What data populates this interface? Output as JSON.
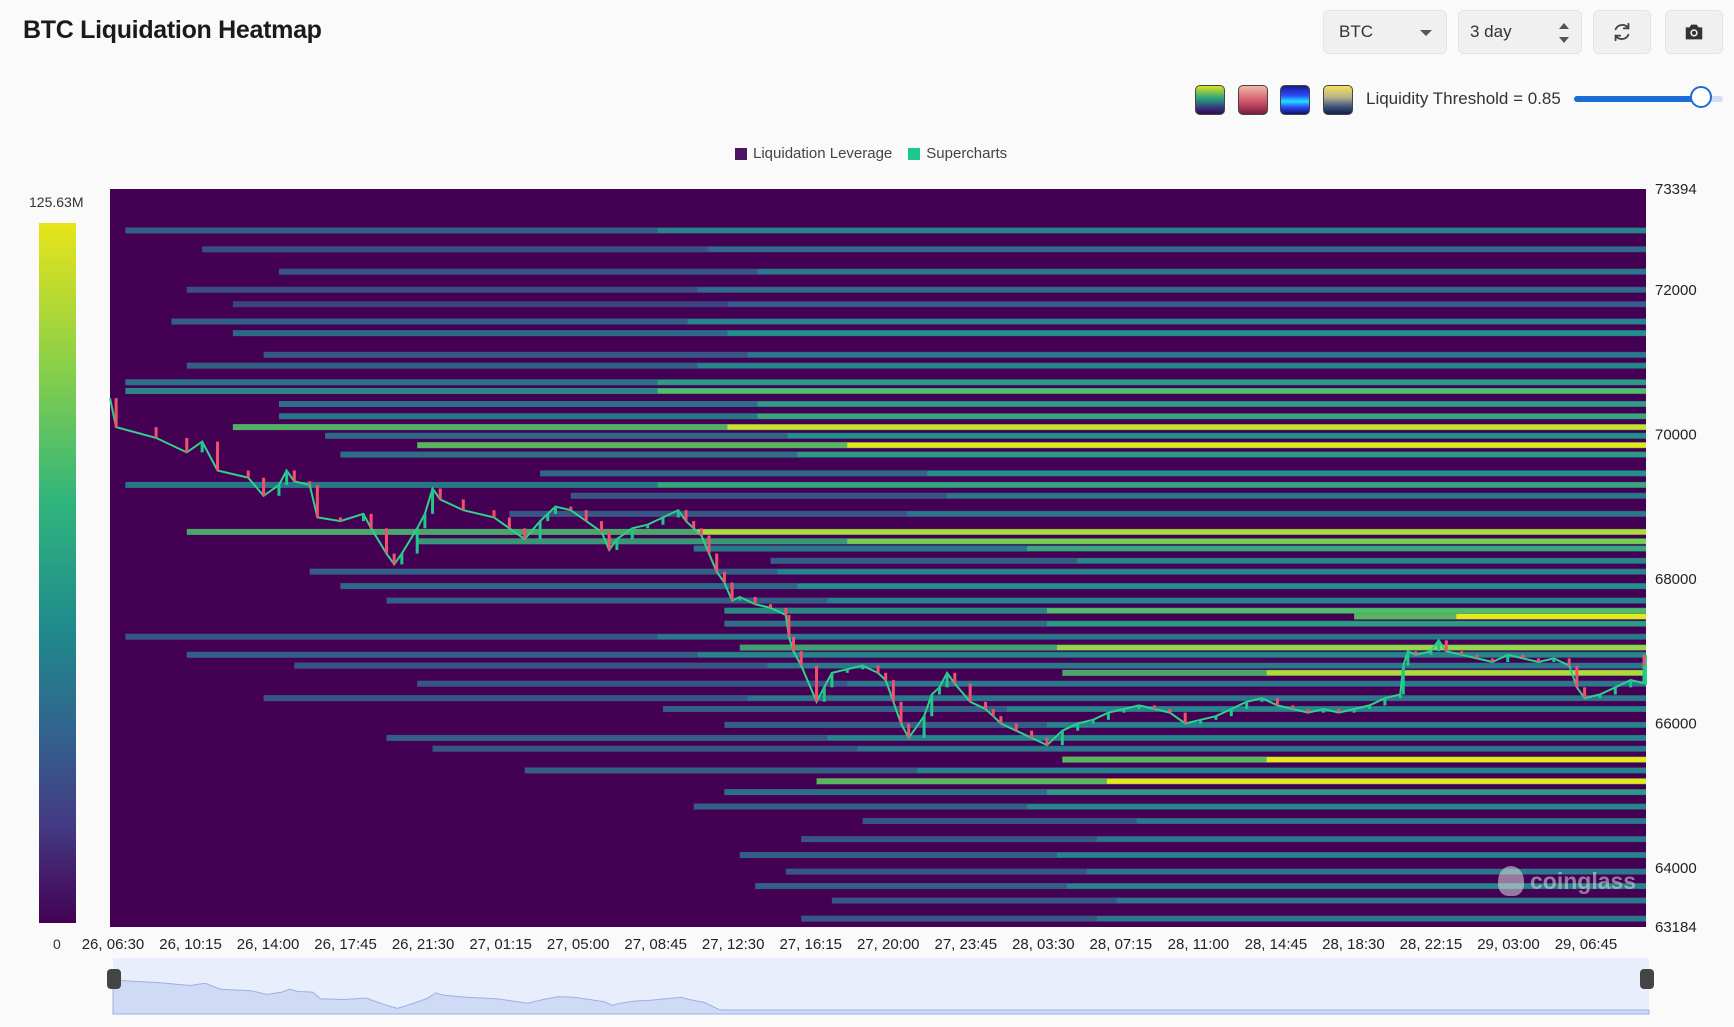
{
  "header": {
    "title": "BTC Liquidation Heatmap",
    "asset_select": "BTC",
    "period_select": "3 day",
    "refresh_icon": "refresh-icon",
    "camera_icon": "camera-icon"
  },
  "palette": {
    "swatches": [
      "viridis",
      "reds",
      "blue-cyan",
      "cividis"
    ],
    "threshold_label": "Liquidity Threshold = 0.85",
    "threshold_value": 0.85
  },
  "legend": {
    "items": [
      {
        "label": "Liquidation Leverage",
        "color": "#4a1560"
      },
      {
        "label": "Supercharts",
        "color": "#1ec88a"
      }
    ]
  },
  "colorbar": {
    "max_label": "125.63M",
    "min_label": "0"
  },
  "chart_data": {
    "type": "heatmap",
    "title": "",
    "x_ticks": [
      "26, 06:30",
      "26, 10:15",
      "26, 14:00",
      "26, 17:45",
      "26, 21:30",
      "27, 01:15",
      "27, 05:00",
      "27, 08:45",
      "27, 12:30",
      "27, 16:15",
      "27, 20:00",
      "27, 23:45",
      "28, 03:30",
      "28, 07:15",
      "28, 11:00",
      "28, 14:45",
      "28, 18:30",
      "28, 22:15",
      "29, 03:00",
      "29, 06:45"
    ],
    "y_ticks": [
      73394,
      72000,
      70000,
      68000,
      66000,
      64000,
      63184
    ],
    "ylim": [
      63184,
      73394
    ],
    "colorbar_range": [
      "0",
      "125.63M"
    ],
    "background_color": "#440154",
    "liquidation_bands": [
      {
        "price": 72820,
        "start": 0.01,
        "intensity": 0.45
      },
      {
        "price": 72560,
        "start": 0.06,
        "intensity": 0.35
      },
      {
        "price": 72250,
        "start": 0.11,
        "intensity": 0.4
      },
      {
        "price": 72000,
        "start": 0.05,
        "intensity": 0.35
      },
      {
        "price": 71800,
        "start": 0.08,
        "intensity": 0.3
      },
      {
        "price": 71560,
        "start": 0.04,
        "intensity": 0.45
      },
      {
        "price": 71400,
        "start": 0.08,
        "intensity": 0.5
      },
      {
        "price": 71100,
        "start": 0.1,
        "intensity": 0.4
      },
      {
        "price": 70950,
        "start": 0.05,
        "intensity": 0.45
      },
      {
        "price": 70720,
        "start": 0.01,
        "intensity": 0.55
      },
      {
        "price": 70600,
        "start": 0.01,
        "intensity": 0.7
      },
      {
        "price": 70420,
        "start": 0.11,
        "intensity": 0.55
      },
      {
        "price": 70250,
        "start": 0.11,
        "intensity": 0.6
      },
      {
        "price": 70100,
        "start": 0.08,
        "intensity": 0.95
      },
      {
        "price": 69980,
        "start": 0.14,
        "intensity": 0.5
      },
      {
        "price": 69850,
        "start": 0.2,
        "intensity": 1.0
      },
      {
        "price": 69720,
        "start": 0.15,
        "intensity": 0.55
      },
      {
        "price": 69460,
        "start": 0.28,
        "intensity": 0.5
      },
      {
        "price": 69300,
        "start": 0.01,
        "intensity": 0.6
      },
      {
        "price": 69150,
        "start": 0.3,
        "intensity": 0.4
      },
      {
        "price": 68900,
        "start": 0.26,
        "intensity": 0.4
      },
      {
        "price": 68650,
        "start": 0.05,
        "intensity": 0.9
      },
      {
        "price": 68520,
        "start": 0.2,
        "intensity": 0.8
      },
      {
        "price": 68420,
        "start": 0.38,
        "intensity": 0.6
      },
      {
        "price": 68250,
        "start": 0.43,
        "intensity": 0.45
      },
      {
        "price": 68100,
        "start": 0.13,
        "intensity": 0.45
      },
      {
        "price": 67900,
        "start": 0.15,
        "intensity": 0.5
      },
      {
        "price": 67700,
        "start": 0.18,
        "intensity": 0.45
      },
      {
        "price": 67560,
        "start": 0.4,
        "intensity": 0.7
      },
      {
        "price": 67480,
        "start": 0.81,
        "intensity": 1.0
      },
      {
        "price": 67380,
        "start": 0.4,
        "intensity": 0.55
      },
      {
        "price": 67200,
        "start": 0.01,
        "intensity": 0.4
      },
      {
        "price": 67050,
        "start": 0.41,
        "intensity": 0.85
      },
      {
        "price": 66950,
        "start": 0.05,
        "intensity": 0.45
      },
      {
        "price": 66800,
        "start": 0.12,
        "intensity": 0.4
      },
      {
        "price": 66700,
        "start": 0.62,
        "intensity": 0.9
      },
      {
        "price": 66550,
        "start": 0.2,
        "intensity": 0.4
      },
      {
        "price": 66350,
        "start": 0.1,
        "intensity": 0.4
      },
      {
        "price": 66200,
        "start": 0.36,
        "intensity": 0.45
      },
      {
        "price": 65980,
        "start": 0.4,
        "intensity": 0.45
      },
      {
        "price": 65800,
        "start": 0.18,
        "intensity": 0.45
      },
      {
        "price": 65650,
        "start": 0.21,
        "intensity": 0.4
      },
      {
        "price": 65500,
        "start": 0.62,
        "intensity": 1.0
      },
      {
        "price": 65350,
        "start": 0.27,
        "intensity": 0.45
      },
      {
        "price": 65200,
        "start": 0.46,
        "intensity": 1.0
      },
      {
        "price": 65050,
        "start": 0.4,
        "intensity": 0.55
      },
      {
        "price": 64850,
        "start": 0.38,
        "intensity": 0.45
      },
      {
        "price": 64650,
        "start": 0.49,
        "intensity": 0.4
      },
      {
        "price": 64400,
        "start": 0.45,
        "intensity": 0.4
      },
      {
        "price": 64180,
        "start": 0.41,
        "intensity": 0.45
      },
      {
        "price": 63950,
        "start": 0.44,
        "intensity": 0.4
      },
      {
        "price": 63750,
        "start": 0.42,
        "intensity": 0.45
      },
      {
        "price": 63550,
        "start": 0.47,
        "intensity": 0.4
      },
      {
        "price": 63300,
        "start": 0.45,
        "intensity": 0.4
      }
    ],
    "price_path": [
      [
        0.0,
        70500
      ],
      [
        0.004,
        70100
      ],
      [
        0.03,
        69950
      ],
      [
        0.05,
        69750
      ],
      [
        0.06,
        69900
      ],
      [
        0.07,
        69500
      ],
      [
        0.09,
        69400
      ],
      [
        0.1,
        69150
      ],
      [
        0.11,
        69300
      ],
      [
        0.115,
        69500
      ],
      [
        0.12,
        69350
      ],
      [
        0.13,
        69300
      ],
      [
        0.135,
        68850
      ],
      [
        0.15,
        68800
      ],
      [
        0.165,
        68900
      ],
      [
        0.17,
        68700
      ],
      [
        0.18,
        68350
      ],
      [
        0.185,
        68200
      ],
      [
        0.19,
        68350
      ],
      [
        0.2,
        68700
      ],
      [
        0.205,
        68900
      ],
      [
        0.21,
        69250
      ],
      [
        0.215,
        69100
      ],
      [
        0.23,
        68950
      ],
      [
        0.25,
        68850
      ],
      [
        0.26,
        68700
      ],
      [
        0.27,
        68550
      ],
      [
        0.28,
        68800
      ],
      [
        0.285,
        68900
      ],
      [
        0.29,
        69000
      ],
      [
        0.3,
        68950
      ],
      [
        0.31,
        68800
      ],
      [
        0.32,
        68650
      ],
      [
        0.325,
        68400
      ],
      [
        0.33,
        68550
      ],
      [
        0.34,
        68700
      ],
      [
        0.35,
        68750
      ],
      [
        0.36,
        68850
      ],
      [
        0.37,
        68950
      ],
      [
        0.375,
        68800
      ],
      [
        0.38,
        68700
      ],
      [
        0.385,
        68600
      ],
      [
        0.39,
        68350
      ],
      [
        0.395,
        68100
      ],
      [
        0.4,
        67950
      ],
      [
        0.405,
        67700
      ],
      [
        0.41,
        67750
      ],
      [
        0.42,
        67650
      ],
      [
        0.43,
        67600
      ],
      [
        0.44,
        67500
      ],
      [
        0.442,
        67200
      ],
      [
        0.445,
        67000
      ],
      [
        0.45,
        66800
      ],
      [
        0.46,
        66300
      ],
      [
        0.465,
        66500
      ],
      [
        0.47,
        66700
      ],
      [
        0.48,
        66750
      ],
      [
        0.49,
        66800
      ],
      [
        0.5,
        66700
      ],
      [
        0.505,
        66600
      ],
      [
        0.51,
        66300
      ],
      [
        0.515,
        66000
      ],
      [
        0.52,
        65800
      ],
      [
        0.53,
        66100
      ],
      [
        0.535,
        66400
      ],
      [
        0.54,
        66500
      ],
      [
        0.545,
        66700
      ],
      [
        0.55,
        66550
      ],
      [
        0.56,
        66300
      ],
      [
        0.57,
        66200
      ],
      [
        0.575,
        66100
      ],
      [
        0.58,
        66000
      ],
      [
        0.59,
        65900
      ],
      [
        0.6,
        65800
      ],
      [
        0.61,
        65700
      ],
      [
        0.62,
        65900
      ],
      [
        0.63,
        66000
      ],
      [
        0.64,
        66050
      ],
      [
        0.65,
        66150
      ],
      [
        0.66,
        66200
      ],
      [
        0.67,
        66250
      ],
      [
        0.68,
        66200
      ],
      [
        0.69,
        66150
      ],
      [
        0.7,
        66000
      ],
      [
        0.71,
        66050
      ],
      [
        0.72,
        66100
      ],
      [
        0.73,
        66200
      ],
      [
        0.74,
        66300
      ],
      [
        0.75,
        66350
      ],
      [
        0.76,
        66250
      ],
      [
        0.77,
        66200
      ],
      [
        0.78,
        66150
      ],
      [
        0.79,
        66200
      ],
      [
        0.8,
        66150
      ],
      [
        0.81,
        66200
      ],
      [
        0.82,
        66250
      ],
      [
        0.83,
        66350
      ],
      [
        0.84,
        66400
      ],
      [
        0.842,
        66800
      ],
      [
        0.845,
        67000
      ],
      [
        0.85,
        66950
      ],
      [
        0.86,
        67000
      ],
      [
        0.865,
        67150
      ],
      [
        0.87,
        67000
      ],
      [
        0.88,
        66950
      ],
      [
        0.89,
        66900
      ],
      [
        0.9,
        66850
      ],
      [
        0.91,
        66950
      ],
      [
        0.92,
        66900
      ],
      [
        0.93,
        66850
      ],
      [
        0.94,
        66900
      ],
      [
        0.95,
        66800
      ],
      [
        0.955,
        66500
      ],
      [
        0.96,
        66350
      ],
      [
        0.97,
        66400
      ],
      [
        0.98,
        66500
      ],
      [
        0.99,
        66600
      ],
      [
        1.0,
        66550
      ],
      [
        1.01,
        66750
      ],
      [
        1.02,
        66950
      ],
      [
        1.03,
        66850
      ],
      [
        1.04,
        66800
      ]
    ]
  }
}
